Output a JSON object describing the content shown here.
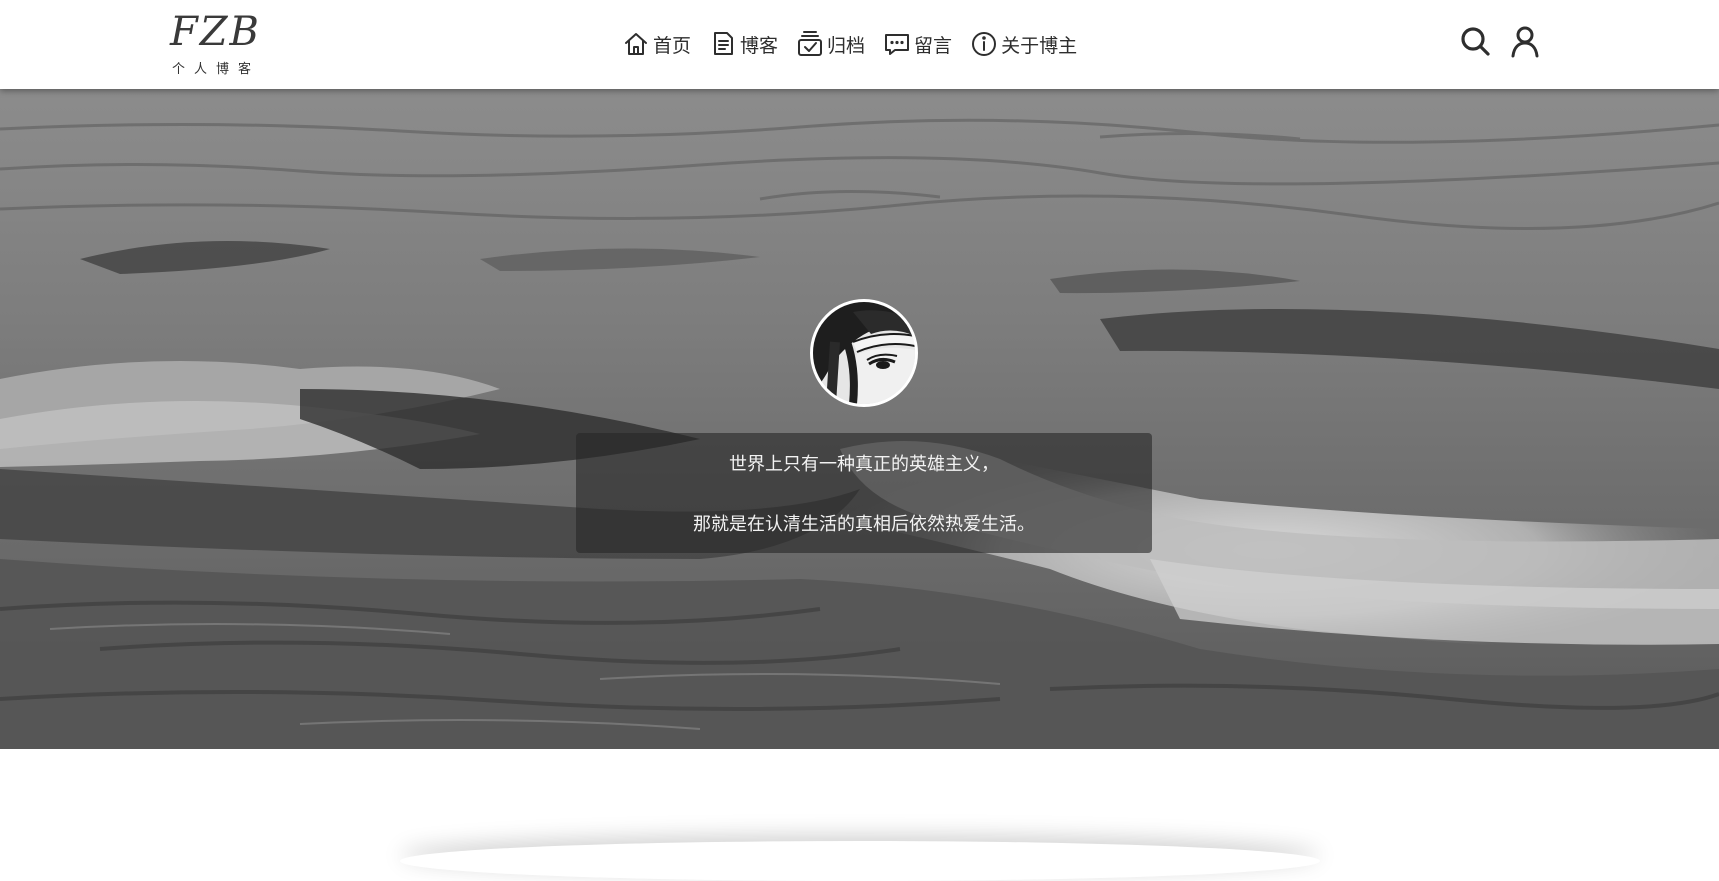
{
  "logo": {
    "mark": "FZB",
    "subtitle": "个人博客"
  },
  "nav": {
    "items": [
      {
        "label": "首页",
        "icon": "home-icon"
      },
      {
        "label": "博客",
        "icon": "document-icon"
      },
      {
        "label": "归档",
        "icon": "archive-icon"
      },
      {
        "label": "留言",
        "icon": "message-icon"
      },
      {
        "label": "关于博主",
        "icon": "info-icon"
      }
    ]
  },
  "actions": {
    "search_icon": "search-icon",
    "user_icon": "user-icon"
  },
  "hero": {
    "quote_line1": "世界上只有一种真正的英雄主义，",
    "quote_line2": "那就是在认清生活的真相后依然热爱生活。"
  },
  "colors": {
    "header_bg": "#ffffff",
    "text_dark": "#2e2e2e",
    "quote_bg": "rgba(40,40,40,0.62)",
    "quote_text": "#f2f2f2"
  }
}
